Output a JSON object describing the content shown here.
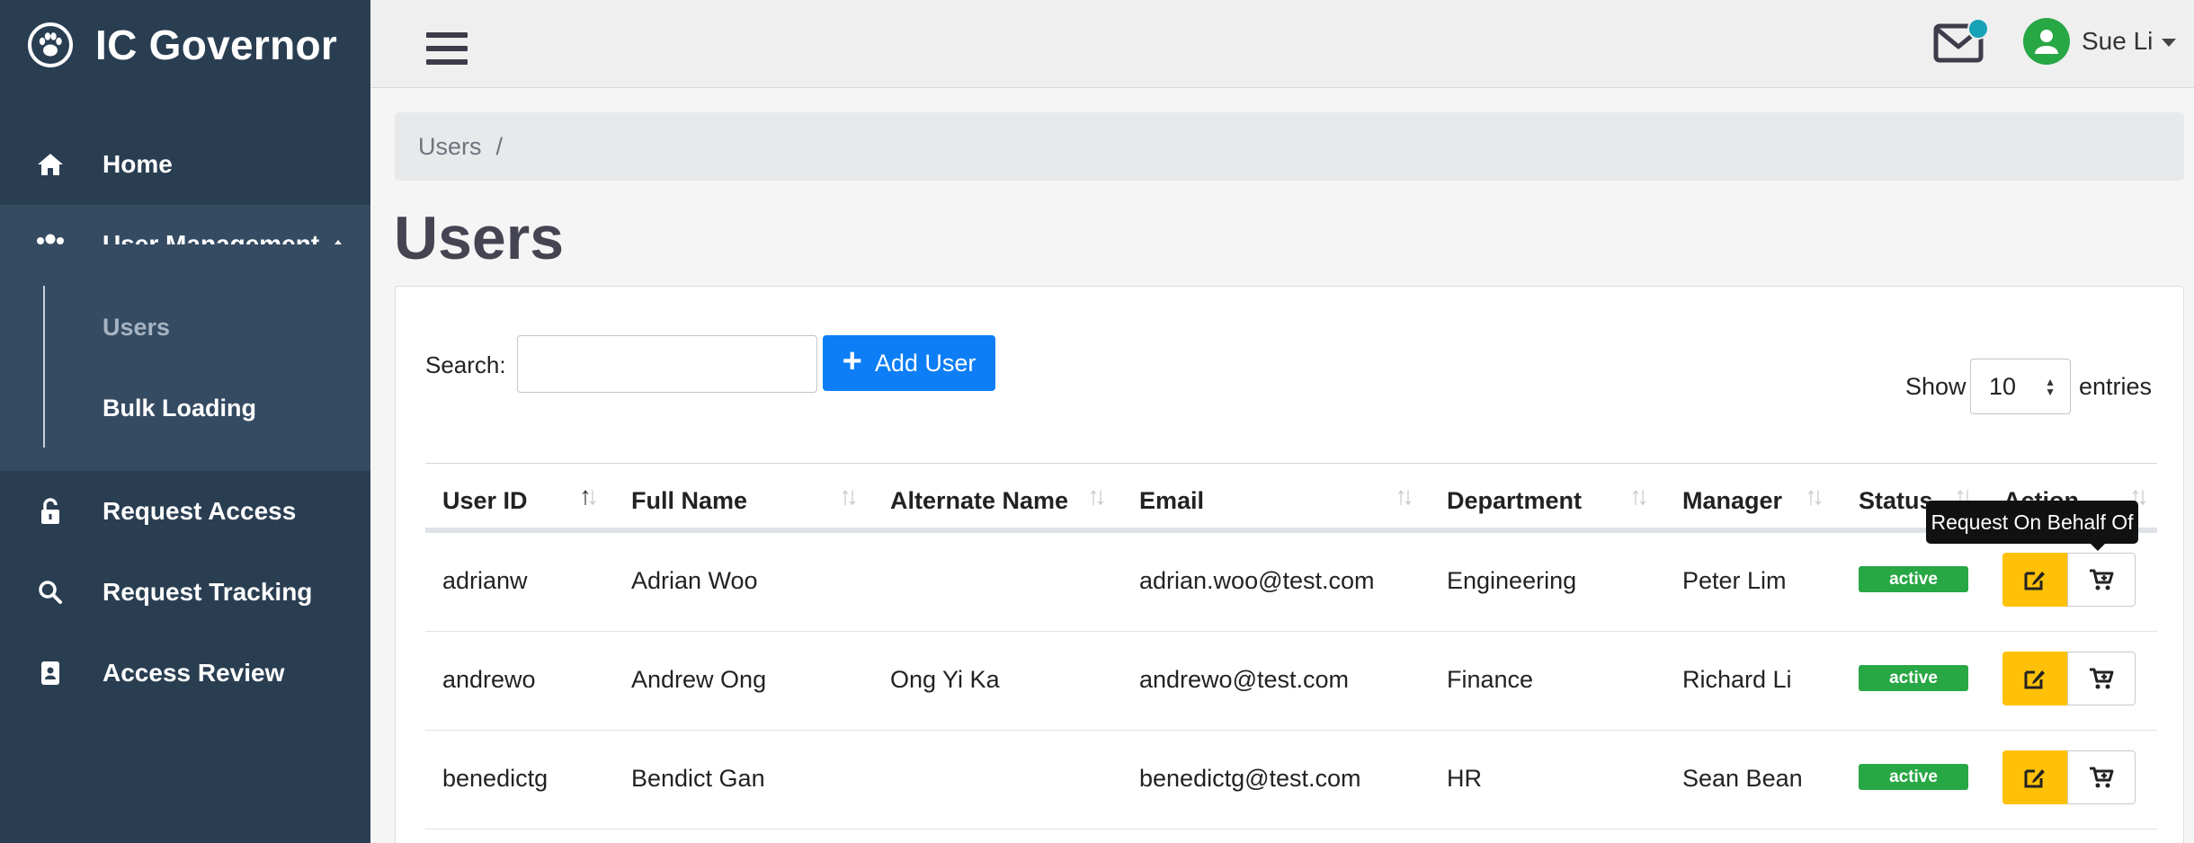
{
  "app": {
    "title": "IC Governor",
    "logo_icon": "paw-icon"
  },
  "sidebar": {
    "items": [
      {
        "label": "Home",
        "icon": "home-icon"
      },
      {
        "label": "User Management",
        "icon": "users-icon"
      },
      {
        "label": "Request Access",
        "icon": "unlock-icon"
      },
      {
        "label": "Request Tracking",
        "icon": "search-icon"
      },
      {
        "label": "Access Review",
        "icon": "id-badge-icon"
      }
    ],
    "submenu": [
      {
        "label": "Users"
      },
      {
        "label": "Bulk Loading"
      }
    ]
  },
  "topbar": {
    "user_name": "Sue Li"
  },
  "breadcrumb": {
    "current": "Users",
    "separator": "/"
  },
  "page": {
    "title": "Users"
  },
  "controls": {
    "search_label": "Search:",
    "search_value": "",
    "add_label": "Add User",
    "show_label": "Show",
    "show_value": "10",
    "entries_label": "entries"
  },
  "table": {
    "headers": [
      "User ID",
      "Full Name",
      "Alternate Name",
      "Email",
      "Department",
      "Manager",
      "Status",
      "Action"
    ],
    "rows": [
      {
        "user_id": "adrianw",
        "full_name": "Adrian Woo",
        "alt_name": "",
        "email": "adrian.woo@test.com",
        "department": "Engineering",
        "manager": "Peter Lim",
        "status": "active"
      },
      {
        "user_id": "andrewo",
        "full_name": "Andrew Ong",
        "alt_name": "Ong Yi Ka",
        "email": "andrewo@test.com",
        "department": "Finance",
        "manager": "Richard Li",
        "status": "active"
      },
      {
        "user_id": "benedictg",
        "full_name": "Bendict Gan",
        "alt_name": "",
        "email": "benedictg@test.com",
        "department": "HR",
        "manager": "Sean Bean",
        "status": "active"
      }
    ]
  },
  "tooltip": {
    "text": "Request On Behalf Of"
  },
  "colors": {
    "sidebar_bg": "#2a3e52",
    "primary": "#0d7ef5",
    "warning": "#ffc107",
    "success": "#28a745",
    "info": "#17a2b8"
  }
}
